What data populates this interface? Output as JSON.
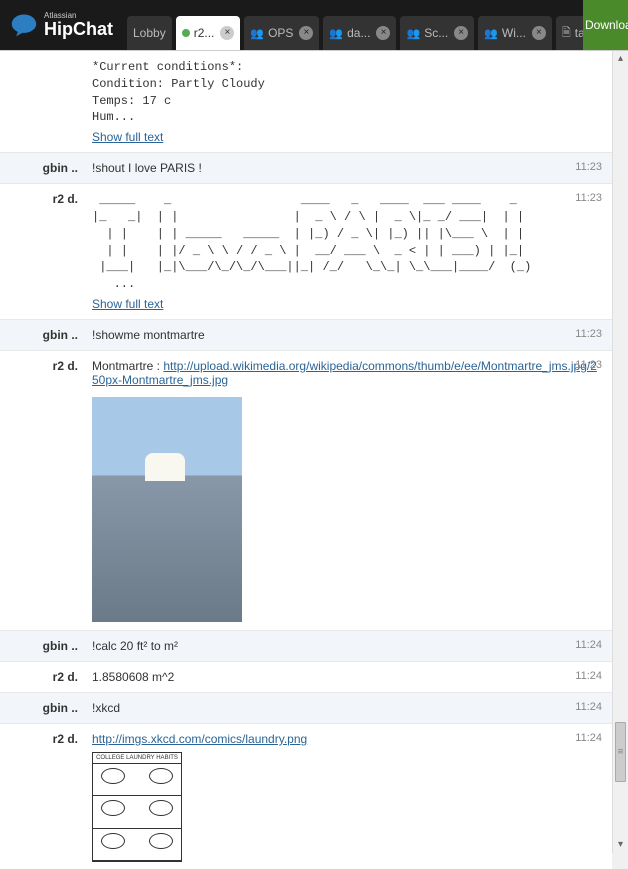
{
  "app": {
    "brand_small": "Atlassian",
    "brand_main": "HipChat"
  },
  "tabs": [
    {
      "label": "Lobby",
      "icon": null,
      "closable": false,
      "active": false
    },
    {
      "label": "r2...",
      "presence": true,
      "closable": true,
      "active": true
    },
    {
      "label": "OPS",
      "people": true,
      "closable": true,
      "active": false
    },
    {
      "label": "da...",
      "people": true,
      "closable": true,
      "active": false
    },
    {
      "label": "Sc...",
      "people": true,
      "closable": true,
      "active": false
    },
    {
      "label": "Wi...",
      "people": true,
      "closable": true,
      "active": false
    },
    {
      "label": "ta...",
      "icon": "doc",
      "closable": true,
      "active": false
    }
  ],
  "download_label": "Download",
  "messages": [
    {
      "sender": "",
      "time": "",
      "type": "mono",
      "body": "*Current conditions*:\nCondition: Partly Cloudy\nTemps: 17 c\nHum...",
      "show_full": "Show full text"
    },
    {
      "sender": "gbin ..",
      "time": "11:23",
      "type": "cmd",
      "body": "!shout I love PARIS !"
    },
    {
      "sender": "r2 d.",
      "time": "11:23",
      "type": "mono",
      "body": " _____    _                  ____   _   ____  ___ ____    _ \n|_   _|  | |                |  _ \\ / \\ |  _ \\|_ _/ ___|  | |\n  | |    | | _____   _____  | |_) / _ \\| |_) || |\\___ \\  | |\n  | |    | |/ _ \\ \\ / / _ \\ |  __/ ___ \\  _ < | | ___) | |_|\n |___|   |_|\\___/\\_/\\_/\\___||_| /_/   \\_\\_| \\_\\___|____/  (_)\n   ...",
      "show_full": "Show full text"
    },
    {
      "sender": "gbin ..",
      "time": "11:23",
      "type": "cmd",
      "body": "!showme montmartre"
    },
    {
      "sender": "r2 d.",
      "time": "11:23",
      "type": "link-image",
      "prefix": "Montmartre : ",
      "url": "http://upload.wikimedia.org/wikipedia/commons/thumb/e/ee/Montmartre_jms.jpg/250px-Montmartre_jms.jpg"
    },
    {
      "sender": "gbin ..",
      "time": "11:24",
      "type": "cmd",
      "body": "!calc 20 ft² to m²"
    },
    {
      "sender": "r2 d.",
      "time": "11:24",
      "type": "plain",
      "body": "1.8580608 m^2"
    },
    {
      "sender": "gbin ..",
      "time": "11:24",
      "type": "cmd",
      "body": "!xkcd"
    },
    {
      "sender": "r2 d.",
      "time": "11:24",
      "type": "link-comic",
      "url": "http://imgs.xkcd.com/comics/laundry.png",
      "comic_title": "COLLEGE LAUNDRY HABITS"
    }
  ]
}
